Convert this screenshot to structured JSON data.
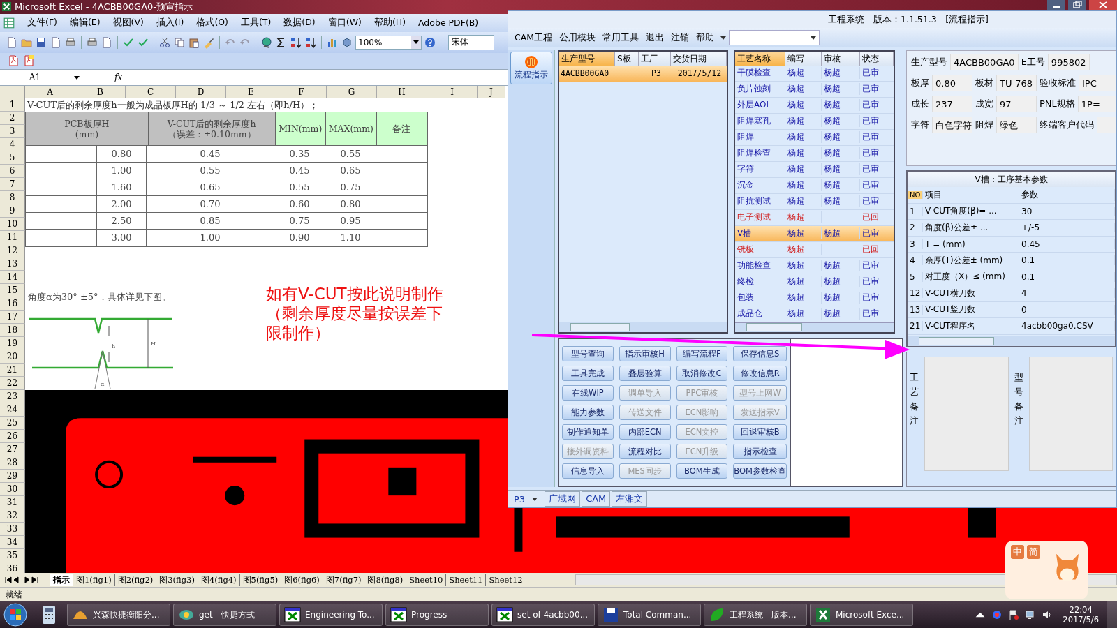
{
  "excel": {
    "title": "Microsoft Excel - 4ACBB00GA0-预审指示",
    "menu": [
      "文件(F)",
      "编辑(E)",
      "视图(V)",
      "插入(I)",
      "格式(O)",
      "工具(T)",
      "数据(D)",
      "窗口(W)",
      "帮助(H)",
      "Adobe PDF(B)"
    ],
    "zoom": "100%",
    "font": "宋体",
    "name_box": "A1",
    "fx": "fx",
    "columns": [
      "A",
      "B",
      "C",
      "D",
      "E",
      "F",
      "G",
      "H",
      "I",
      "J"
    ],
    "rows": [
      "1",
      "2",
      "3",
      "4",
      "5",
      "6",
      "7",
      "8",
      "9",
      "10",
      "11",
      "12",
      "13",
      "14",
      "15",
      "16",
      "17",
      "18",
      "19",
      "20",
      "21",
      "22",
      "23",
      "24",
      "25",
      "26",
      "27",
      "28",
      "29",
      "30",
      "31",
      "32",
      "33",
      "34",
      "35",
      "36"
    ],
    "heading": "V-CUT后的剩余厚度h一般为成品板厚H的 1/3 ～ 1/2 左右（即h/H）；",
    "table": {
      "headers": [
        {
          "lines": [
            "PCB板厚H",
            "(mm)"
          ],
          "color": "#c0c0c0"
        },
        {
          "lines": [
            "V-CUT后的剩余厚度h",
            "（误差：±0.10mm）"
          ],
          "color": "#c0c0c0"
        },
        {
          "lines": [
            "MIN(mm)"
          ],
          "color": "#ccffcc"
        },
        {
          "lines": [
            "MAX(mm)"
          ],
          "color": "#ccffcc"
        },
        {
          "lines": [
            "备注"
          ],
          "color": "#ccffcc"
        }
      ],
      "rows": [
        [
          "0.80",
          "0.45",
          "0.35",
          "0.55"
        ],
        [
          "1.00",
          "0.55",
          "0.45",
          "0.65"
        ],
        [
          "1.60",
          "0.65",
          "0.55",
          "0.75"
        ],
        [
          "2.00",
          "0.70",
          "0.60",
          "0.80"
        ],
        [
          "2.50",
          "0.85",
          "0.75",
          "0.95"
        ],
        [
          "3.00",
          "1.00",
          "0.90",
          "1.10"
        ]
      ]
    },
    "angle_note": "角度α为30°  ±5°．具体详见下图。",
    "diagram_labels": [
      "h",
      "H",
      "α"
    ],
    "red_note": [
      "如有V-CUT按此说明制作",
      "（剩余厚度尽量按误差下",
      "限制作）"
    ],
    "sheet_tabs": [
      {
        "label": "指示",
        "selected": true
      },
      {
        "label": "图1(fig1)",
        "selected": false
      },
      {
        "label": "图2(fig2)",
        "selected": false
      },
      {
        "label": "图3(fig3)",
        "selected": false
      },
      {
        "label": "图4(fig4)",
        "selected": false
      },
      {
        "label": "图5(fig5)",
        "selected": false
      },
      {
        "label": "图6(fig6)",
        "selected": false
      },
      {
        "label": "图7(fig7)",
        "selected": false
      },
      {
        "label": "图8(fig8)",
        "selected": false
      },
      {
        "label": "Sheet10",
        "selected": false
      },
      {
        "label": "Sheet11",
        "selected": false
      },
      {
        "label": "Sheet12",
        "selected": false
      }
    ],
    "status": "就绪"
  },
  "app": {
    "title": "工程系统　版本：1.1.51.3 - [流程指示]",
    "menu": [
      "CAM工程",
      "公用模块",
      "常用工具",
      "退出",
      "注销",
      "帮助"
    ],
    "nav": [
      {
        "label": "流程指示",
        "selected": true
      }
    ],
    "orders": {
      "columns": [
        "生产型号",
        "S板",
        "工厂",
        "交货日期"
      ],
      "rows": [
        {
          "model": "4ACBB00GA0",
          "factory": "P3",
          "date": "2017/5/12",
          "selected": true
        }
      ]
    },
    "processes": {
      "columns": [
        "工艺名称",
        "编写",
        "审核",
        "状态"
      ],
      "rows": [
        {
          "name": "干膜检查",
          "writer": "杨超",
          "reviewer": "杨超",
          "status": "已审",
          "kind": "approved",
          "selected": false
        },
        {
          "name": "负片蚀刻",
          "writer": "杨超",
          "reviewer": "杨超",
          "status": "已审",
          "kind": "approved",
          "selected": false
        },
        {
          "name": "外层AOI",
          "writer": "杨超",
          "reviewer": "杨超",
          "status": "已审",
          "kind": "approved",
          "selected": false
        },
        {
          "name": "阻焊塞孔",
          "writer": "杨超",
          "reviewer": "杨超",
          "status": "已审",
          "kind": "approved",
          "selected": false
        },
        {
          "name": "阻焊",
          "writer": "杨超",
          "reviewer": "杨超",
          "status": "已审",
          "kind": "approved",
          "selected": false
        },
        {
          "name": "阻焊检查",
          "writer": "杨超",
          "reviewer": "杨超",
          "status": "已审",
          "kind": "approved",
          "selected": false
        },
        {
          "name": "字符",
          "writer": "杨超",
          "reviewer": "杨超",
          "status": "已审",
          "kind": "approved",
          "selected": false
        },
        {
          "name": "沉金",
          "writer": "杨超",
          "reviewer": "杨超",
          "status": "已审",
          "kind": "approved",
          "selected": false
        },
        {
          "name": "阻抗测试",
          "writer": "杨超",
          "reviewer": "杨超",
          "status": "已审",
          "kind": "approved",
          "selected": false
        },
        {
          "name": "电子测试",
          "writer": "杨超",
          "status": "已回",
          "kind": "returned",
          "selected": false
        },
        {
          "name": "V槽",
          "writer": "杨超",
          "reviewer": "杨超",
          "status": "已审",
          "kind": "approved",
          "selected": true
        },
        {
          "name": "铣板",
          "writer": "杨超",
          "status": "已回",
          "kind": "returned",
          "selected": false
        },
        {
          "name": "功能检查",
          "writer": "杨超",
          "reviewer": "杨超",
          "status": "已审",
          "kind": "approved",
          "selected": false
        },
        {
          "name": "终检",
          "writer": "杨超",
          "reviewer": "杨超",
          "status": "已审",
          "kind": "approved",
          "selected": false
        },
        {
          "name": "包装",
          "writer": "杨超",
          "reviewer": "杨超",
          "status": "已审",
          "kind": "approved",
          "selected": false
        },
        {
          "name": "成品仓",
          "writer": "杨超",
          "reviewer": "杨超",
          "status": "已审",
          "kind": "approved",
          "selected": false
        }
      ]
    },
    "field_rows": [
      [
        {
          "label": "生产型号",
          "value": "4ACBB00GA0"
        },
        {
          "label": "E工号",
          "value": "995802"
        }
      ],
      [
        {
          "label": "板厚",
          "value": "0.80"
        },
        {
          "label": "板材",
          "value": "TU-768"
        },
        {
          "label": "验收标准",
          "value": "IPC-"
        }
      ],
      [
        {
          "label": "成长",
          "value": "237"
        },
        {
          "label": "成宽",
          "value": "97"
        },
        {
          "label": "PNL规格",
          "value": "1P="
        }
      ],
      [
        {
          "label": "字符",
          "value": "白色字符"
        },
        {
          "label": "阻焊",
          "value": "绿色"
        },
        {
          "label": "终端客户代码"
        }
      ]
    ],
    "params": {
      "title": "V槽：工序基本参数",
      "columns": [
        "NO",
        "项目",
        "参数"
      ],
      "rows": [
        {
          "no": "1",
          "item": "V-CUT角度(β)=  ...",
          "value": "30"
        },
        {
          "no": "2",
          "item": "角度(β)公差±  ...",
          "value": "+/-5"
        },
        {
          "no": "3",
          "item": "T =  (mm)",
          "value": "0.45"
        },
        {
          "no": "4",
          "item": "余厚(T)公差±  (mm)",
          "value": "0.1"
        },
        {
          "no": "5",
          "item": "对正度（X）≤ (mm)",
          "value": "0.1"
        },
        {
          "no": "12",
          "item": "V-CUT横刀数",
          "value": "4"
        },
        {
          "no": "13",
          "item": "V-CUT竖刀数",
          "value": "0"
        },
        {
          "no": "21",
          "item": "V-CUT程序名",
          "value": "4acbb00ga0.CSV"
        }
      ]
    },
    "buttons": [
      {
        "label": "型号查询",
        "disabled": false
      },
      {
        "label": "指示审核H",
        "disabled": false
      },
      {
        "label": "编写流程F",
        "disabled": false
      },
      {
        "label": "保存信息S",
        "disabled": false
      },
      {
        "label": "工具完成",
        "disabled": false
      },
      {
        "label": "叠层验算",
        "disabled": false
      },
      {
        "label": "取消修改C",
        "disabled": false
      },
      {
        "label": "修改信息R",
        "disabled": false
      },
      {
        "label": "在线WIP",
        "disabled": false
      },
      {
        "label": "调单导入",
        "disabled": true
      },
      {
        "label": "PPC审核",
        "disabled": true
      },
      {
        "label": "型号上网W",
        "disabled": true
      },
      {
        "label": "能力参数",
        "disabled": false
      },
      {
        "label": "传送文件",
        "disabled": true
      },
      {
        "label": "ECN影响",
        "disabled": true
      },
      {
        "label": "发送指示V",
        "disabled": true
      },
      {
        "label": "制作通知单",
        "disabled": false
      },
      {
        "label": "内部ECN",
        "disabled": false
      },
      {
        "label": "ECN文控",
        "disabled": true
      },
      {
        "label": "回退审核B",
        "disabled": false
      },
      {
        "label": "接外调资料",
        "disabled": true
      },
      {
        "label": "流程对比",
        "disabled": false
      },
      {
        "label": "ECN升级",
        "disabled": true
      },
      {
        "label": "指示检查",
        "disabled": false
      },
      {
        "label": "信息导入",
        "disabled": false
      },
      {
        "label": "MES同步",
        "disabled": true
      },
      {
        "label": "BOM生成",
        "disabled": false
      },
      {
        "label": "BOM参数检查",
        "disabled": false
      }
    ],
    "remarks": [
      "工艺备注",
      "型号备注"
    ],
    "bottom": {
      "factory": "P3",
      "tabs": [
        "广域网",
        "CAM",
        "左湘文"
      ]
    }
  },
  "ime": [
    "中",
    "简"
  ],
  "taskbar": {
    "items": [
      {
        "label": "兴森快捷衡阳分...",
        "kind": "shell"
      },
      {
        "label": "get - 快捷方式",
        "kind": "link"
      },
      {
        "label": "Engineering To...",
        "kind": "xwin"
      },
      {
        "label": "Progress",
        "kind": "xwin"
      },
      {
        "label": "set of 4acbb00...",
        "kind": "xwin"
      },
      {
        "label": "Total Comman...",
        "kind": "floppy"
      },
      {
        "label": "工程系统　版本...",
        "kind": "leaf"
      },
      {
        "label": "Microsoft Exce...",
        "kind": "excel"
      }
    ],
    "time": "22:04",
    "date": "2017/5/6"
  }
}
